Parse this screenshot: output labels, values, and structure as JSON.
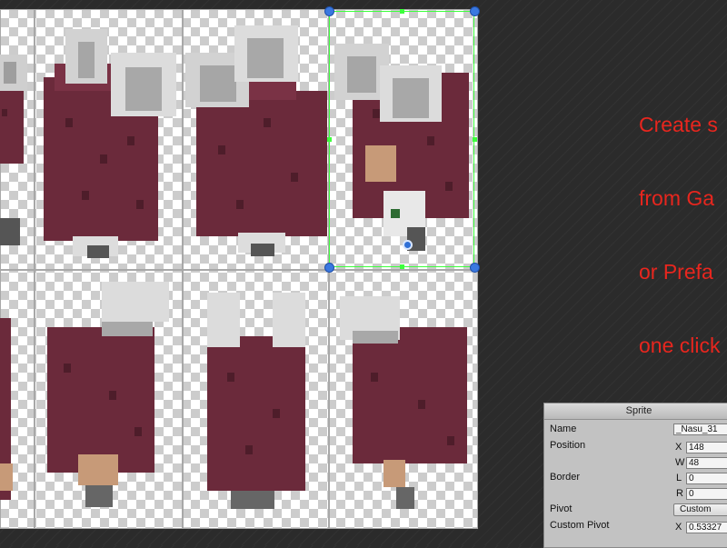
{
  "promo": {
    "lines": [
      "Create s",
      "from Ga",
      "or Prefa",
      "one click"
    ]
  },
  "sprite_panel": {
    "title": "Sprite",
    "name_label": "Name",
    "name_value": "_Nasu_31",
    "position_label": "Position",
    "x_label": "X",
    "x_value": "148",
    "w_label": "W",
    "w_value": "48",
    "border_label": "Border",
    "l_label": "L",
    "l_value": "0",
    "r_label": "R",
    "r_value": "0",
    "pivot_label": "Pivot",
    "pivot_value": "Custom",
    "custom_pivot_label": "Custom Pivot",
    "cp_x_label": "X",
    "cp_x_value": "0.53327"
  },
  "colors": {
    "promo_text": "#e8261e",
    "hair_maroon": "#6b2a3b",
    "hair_dark": "#4e1d2a",
    "ears_grey": "#d2d2d2",
    "selection_green": "#3dff3d",
    "handle_blue": "#3a78e0"
  }
}
